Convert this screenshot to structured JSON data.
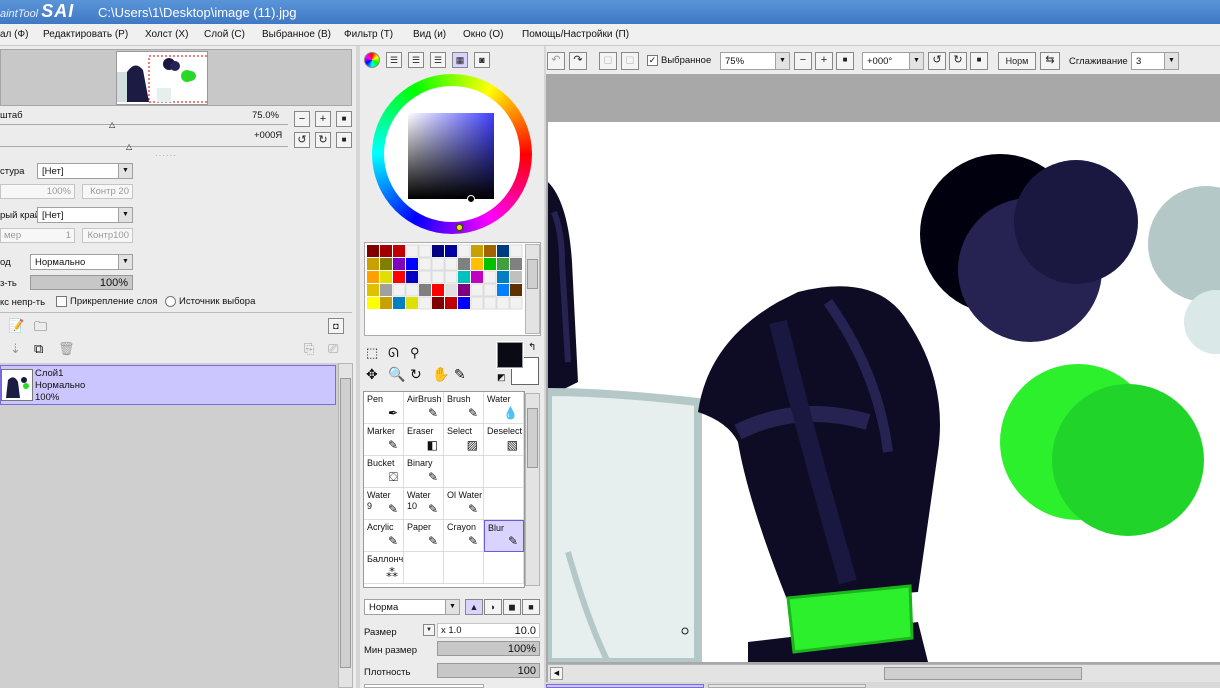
{
  "titlebar": {
    "logo_small": "aintTool",
    "logo_big": "SAI",
    "path": "C:\\Users\\1\\Desktop\\image (11).jpg"
  },
  "menu": [
    "ал (Ф)",
    "Редактировать (Р)",
    "Холст (Х)",
    "Слой (С)",
    "Выбранное (В)",
    "Фильтр (Т)",
    "Вид (и)",
    "Окно (О)",
    "Помощь/Настройки (П)"
  ],
  "nav": {
    "zoom_label": "штаб",
    "zoom_value": "75.0%",
    "rotation_value": "+000Я"
  },
  "layer_props": {
    "texture_label": "стура",
    "texture_value": "[Нет]",
    "tex_percent": "100%",
    "tex_contr": "Контр 20",
    "edge_label": "рый край",
    "edge_value": "[Нет]",
    "edge_size": "мер",
    "edge_num": "1",
    "edge_contr": "Контр100",
    "mode_label": "од",
    "mode_value": "Нормально",
    "opacity_label": "з-ть",
    "opacity_value": "100%",
    "protect_label": "кс непр-ть",
    "clip_label": "Прикрепление слоя",
    "source_label": "Источник выбора"
  },
  "layers": [
    {
      "name": "Слой1",
      "mode": "Нормально",
      "opacity": "100%"
    }
  ],
  "tools": [
    {
      "label": "Pen",
      "icon": "pen-icon"
    },
    {
      "label": "AirBrush",
      "icon": "airbrush-icon"
    },
    {
      "label": "Brush",
      "icon": "brush-icon"
    },
    {
      "label": "Water",
      "icon": "water-icon"
    },
    {
      "label": "Marker",
      "icon": "marker-icon"
    },
    {
      "label": "Eraser",
      "icon": "eraser-icon"
    },
    {
      "label": "Select",
      "icon": "select-icon"
    },
    {
      "label": "Deselect",
      "icon": "deselect-icon"
    },
    {
      "label": "Bucket",
      "icon": "bucket-icon"
    },
    {
      "label": "Binary",
      "icon": "binary-icon"
    },
    {
      "label": "",
      "icon": ""
    },
    {
      "label": "",
      "icon": ""
    },
    {
      "label": "Water\n9",
      "icon": "water9-icon"
    },
    {
      "label": "Water\n10",
      "icon": "water10-icon"
    },
    {
      "label": "Ol Water",
      "icon": "oil-water-icon"
    },
    {
      "label": "",
      "icon": ""
    },
    {
      "label": "Acrylic",
      "icon": "acrylic-icon"
    },
    {
      "label": "Paper",
      "icon": "paper-icon"
    },
    {
      "label": "Crayon",
      "icon": "crayon-icon"
    },
    {
      "label": "Blur",
      "icon": "blur-icon"
    },
    {
      "label": "Баллонч",
      "icon": "spray-icon"
    },
    {
      "label": "",
      "icon": ""
    },
    {
      "label": "",
      "icon": ""
    },
    {
      "label": "",
      "icon": ""
    }
  ],
  "brush": {
    "mode": "Норма",
    "size_label": "Размер",
    "size_mult": "x 1.0",
    "size_value": "10.0",
    "minsize_label": "Мин размер",
    "minsize_value": "100%",
    "density_label": "Плотность",
    "density_value": "100"
  },
  "canvas_toolbar": {
    "selection_label": "Выбранное",
    "zoom": "75%",
    "angle": "+000°",
    "mode_btn": "Норм",
    "smoothing_label": "Сглаживание",
    "smoothing_value": "3"
  },
  "colors": {
    "primary": "#0a0a14",
    "accent": "#6a5ae0",
    "selected_layer": "#ccc6ff"
  },
  "palette": [
    "#800000",
    "#a00000",
    "#c00000",
    "",
    "",
    "#000080",
    "#0000a0",
    "",
    "#c8a000",
    "#a06400",
    "#003c80",
    "",
    "#c8a000",
    "#808000",
    "#8000c0",
    "#0000ff",
    "",
    "",
    "",
    "#808080",
    "#ffc000",
    "#00c000",
    "#40a040",
    "#808080",
    "#ffa000",
    "#e0e000",
    "#ff0000",
    "#0000c0",
    "",
    "",
    "",
    "#00c0c0",
    "#c000c0",
    "",
    "#0080c0",
    "#c0c0c0",
    "#e0c000",
    "#a0a0a0",
    "",
    "",
    "#808080",
    "#ff0000",
    "#e0e0e0",
    "#800080",
    "",
    "",
    "#0080ff",
    "#603000",
    "#ffff00",
    "#c8a000",
    "#0080c0",
    "#e0e000",
    "",
    "#800000",
    "#c00000",
    "#0000ff",
    "",
    "",
    "",
    ""
  ]
}
